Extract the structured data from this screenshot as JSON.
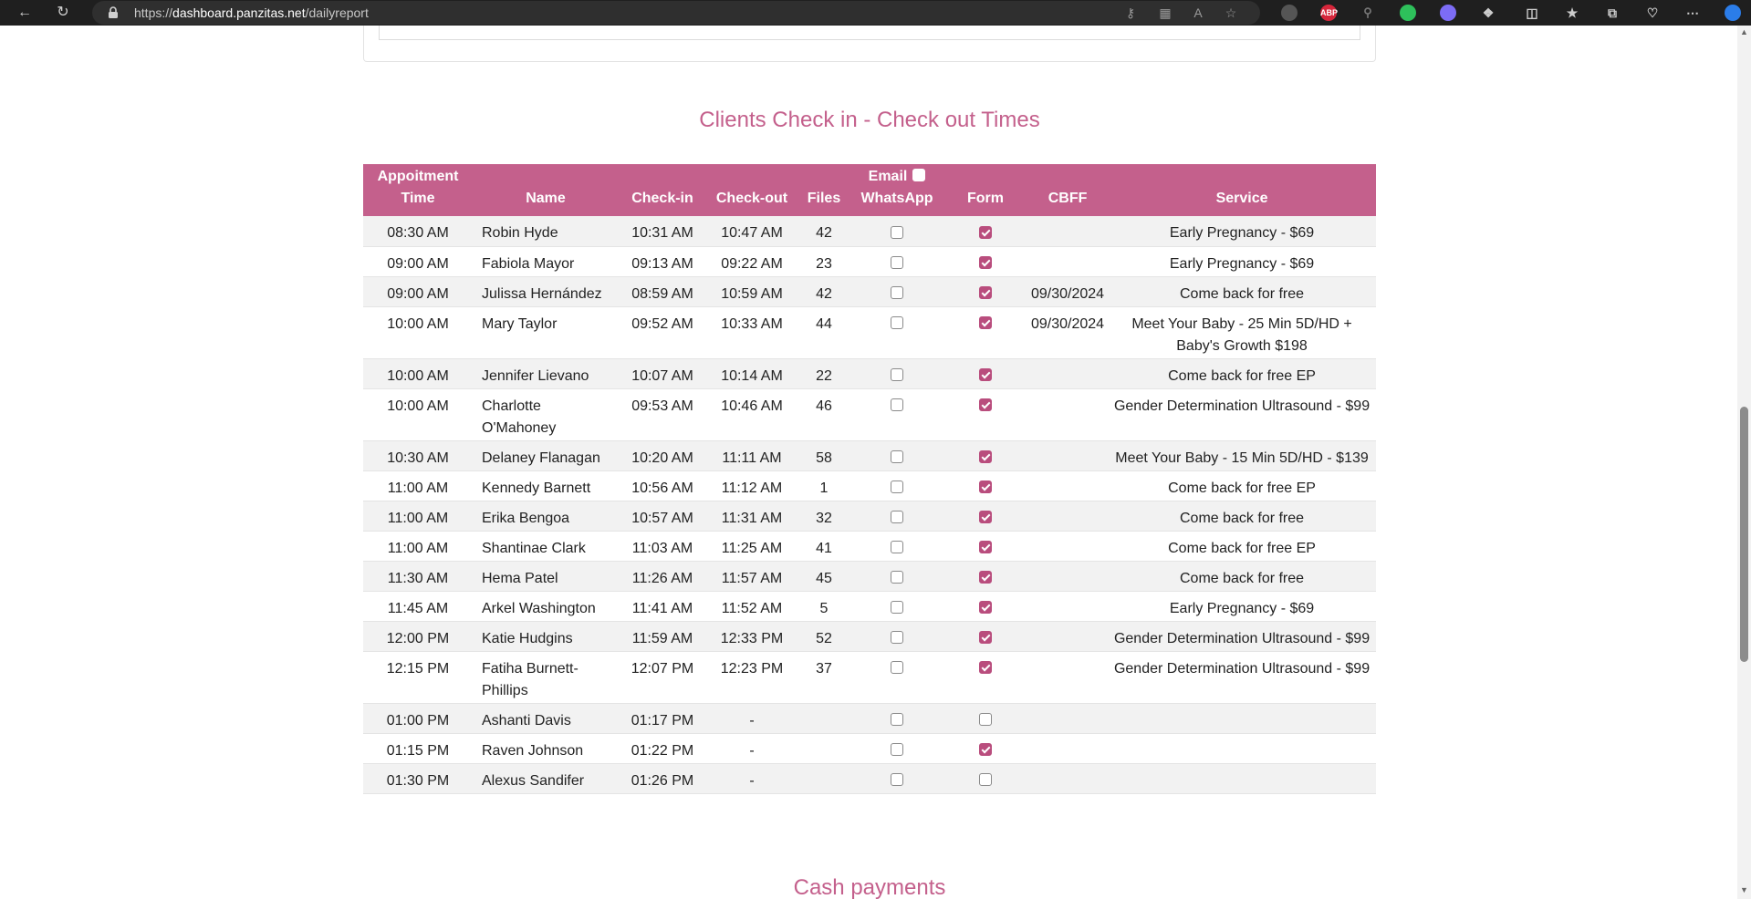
{
  "browser": {
    "url_prefix": "https://",
    "url_domain": "dashboard.panzitas.net",
    "url_path": "/dailyreport",
    "extension_abp": "ABP"
  },
  "section": {
    "title": "Clients Check in - Check out Times",
    "next_title": "Cash payments"
  },
  "table": {
    "headers": {
      "appointment_line1": "Appoitment",
      "appointment_line2": "Time",
      "name": "Name",
      "checkin": "Check-in",
      "checkout": "Check-out",
      "files": "Files",
      "email": "Email",
      "whatsapp": "WhatsApp",
      "form": "Form",
      "cbff": "CBFF",
      "service": "Service"
    },
    "email_all_checked": false,
    "rows": [
      {
        "time": "08:30 AM",
        "name": "Robin Hyde",
        "checkin": "10:31 AM",
        "checkout": "10:47 AM",
        "files": "42",
        "whatsapp": false,
        "form": true,
        "cbff": "",
        "service": "Early Pregnancy - $69"
      },
      {
        "time": "09:00 AM",
        "name": "Fabiola Mayor",
        "checkin": "09:13 AM",
        "checkout": "09:22 AM",
        "files": "23",
        "whatsapp": false,
        "form": true,
        "cbff": "",
        "service": "Early Pregnancy - $69"
      },
      {
        "time": "09:00 AM",
        "name": "Julissa Hernández",
        "checkin": "08:59 AM",
        "checkout": "10:59 AM",
        "files": "42",
        "whatsapp": false,
        "form": true,
        "cbff": "09/30/2024",
        "service": "Come back for free"
      },
      {
        "time": "10:00 AM",
        "name": "Mary Taylor",
        "checkin": "09:52 AM",
        "checkout": "10:33 AM",
        "files": "44",
        "whatsapp": false,
        "form": true,
        "cbff": "09/30/2024",
        "service": "Meet Your Baby - 25 Min 5D/HD + Baby's Growth $198"
      },
      {
        "time": "10:00 AM",
        "name": "Jennifer Lievano",
        "checkin": "10:07 AM",
        "checkout": "10:14 AM",
        "files": "22",
        "whatsapp": false,
        "form": true,
        "cbff": "",
        "service": "Come back for free EP"
      },
      {
        "time": "10:00 AM",
        "name": "Charlotte O'Mahoney",
        "checkin": "09:53 AM",
        "checkout": "10:46 AM",
        "files": "46",
        "whatsapp": false,
        "form": true,
        "cbff": "",
        "service": "Gender Determination Ultrasound - $99"
      },
      {
        "time": "10:30 AM",
        "name": "Delaney Flanagan",
        "checkin": "10:20 AM",
        "checkout": "11:11 AM",
        "files": "58",
        "whatsapp": false,
        "form": true,
        "cbff": "",
        "service": "Meet Your Baby - 15 Min 5D/HD - $139"
      },
      {
        "time": "11:00 AM",
        "name": "Kennedy Barnett",
        "checkin": "10:56 AM",
        "checkout": "11:12 AM",
        "files": "1",
        "whatsapp": false,
        "form": true,
        "cbff": "",
        "service": "Come back for free EP"
      },
      {
        "time": "11:00 AM",
        "name": "Erika Bengoa",
        "checkin": "10:57 AM",
        "checkout": "11:31 AM",
        "files": "32",
        "whatsapp": false,
        "form": true,
        "cbff": "",
        "service": "Come back for free"
      },
      {
        "time": "11:00 AM",
        "name": "Shantinae Clark",
        "checkin": "11:03 AM",
        "checkout": "11:25 AM",
        "files": "41",
        "whatsapp": false,
        "form": true,
        "cbff": "",
        "service": "Come back for free EP"
      },
      {
        "time": "11:30 AM",
        "name": "Hema Patel",
        "checkin": "11:26 AM",
        "checkout": "11:57 AM",
        "files": "45",
        "whatsapp": false,
        "form": true,
        "cbff": "",
        "service": "Come back for free"
      },
      {
        "time": "11:45 AM",
        "name": "Arkel Washington",
        "checkin": "11:41 AM",
        "checkout": "11:52 AM",
        "files": "5",
        "whatsapp": false,
        "form": true,
        "cbff": "",
        "service": "Early Pregnancy - $69"
      },
      {
        "time": "12:00 PM",
        "name": "Katie Hudgins",
        "checkin": "11:59 AM",
        "checkout": "12:33 PM",
        "files": "52",
        "whatsapp": false,
        "form": true,
        "cbff": "",
        "service": "Gender Determination Ultrasound - $99"
      },
      {
        "time": "12:15 PM",
        "name": "Fatiha Burnett-Phillips",
        "checkin": "12:07 PM",
        "checkout": "12:23 PM",
        "files": "37",
        "whatsapp": false,
        "form": true,
        "cbff": "",
        "service": "Gender Determination Ultrasound - $99"
      },
      {
        "time": "01:00 PM",
        "name": "Ashanti Davis",
        "checkin": "01:17 PM",
        "checkout": "-",
        "files": "",
        "whatsapp": false,
        "form": false,
        "cbff": "",
        "service": ""
      },
      {
        "time": "01:15 PM",
        "name": "Raven Johnson",
        "checkin": "01:22 PM",
        "checkout": "-",
        "files": "",
        "whatsapp": false,
        "form": true,
        "cbff": "",
        "service": ""
      },
      {
        "time": "01:30 PM",
        "name": "Alexus Sandifer",
        "checkin": "01:26 PM",
        "checkout": "-",
        "files": "",
        "whatsapp": false,
        "form": false,
        "cbff": "",
        "service": ""
      }
    ]
  },
  "colors": {
    "accent": "#c4608c",
    "checkbox_checked": "#b94d7d",
    "row_alt": "#f2f2f2"
  }
}
